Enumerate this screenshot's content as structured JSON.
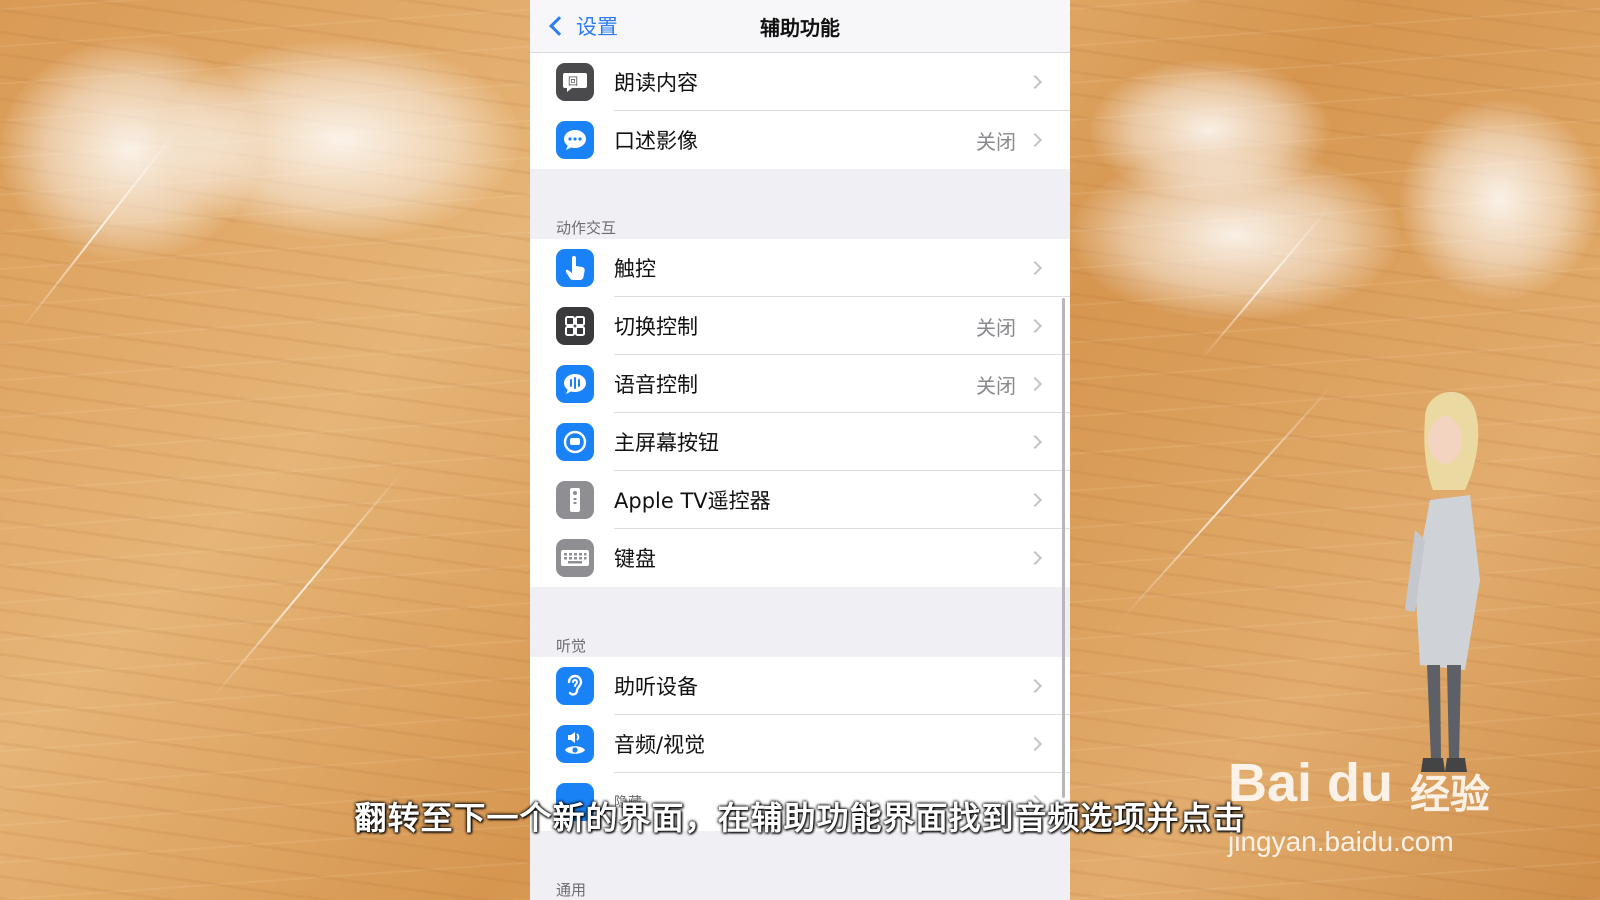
{
  "nav": {
    "back_label": "设置",
    "title": "辅助功能"
  },
  "groups": [
    {
      "header": "",
      "rows": [
        {
          "label": "朗读内容",
          "value": "",
          "icon": "speech-bubble-icon",
          "color": "#4a4a4d"
        },
        {
          "label": "口述影像",
          "value": "关闭",
          "icon": "chat-bubble-icon",
          "color": "#1a82f7"
        }
      ]
    },
    {
      "header": "动作交互",
      "rows": [
        {
          "label": "触控",
          "value": "",
          "icon": "hand-pointer-icon",
          "color": "#1a82f7"
        },
        {
          "label": "切换控制",
          "value": "关闭",
          "icon": "grid-icon",
          "color": "#3a3a3c"
        },
        {
          "label": "语音控制",
          "value": "关闭",
          "icon": "voice-bubble-icon",
          "color": "#1a82f7"
        },
        {
          "label": "主屏幕按钮",
          "value": "",
          "icon": "home-button-icon",
          "color": "#1a82f7"
        },
        {
          "label": "Apple TV遥控器",
          "value": "",
          "icon": "remote-icon",
          "color": "#8e8e93"
        },
        {
          "label": "键盘",
          "value": "",
          "icon": "keyboard-icon",
          "color": "#8e8e93"
        }
      ]
    },
    {
      "header": "听觉",
      "rows": [
        {
          "label": "助听设备",
          "value": "",
          "icon": "ear-icon",
          "color": "#1a82f7"
        },
        {
          "label": "音频/视觉",
          "value": "",
          "icon": "speaker-eye-icon",
          "color": "#1a82f7"
        },
        {
          "label": "隐藏",
          "value": "",
          "icon": "captions-icon",
          "color": "#1a82f7"
        }
      ]
    },
    {
      "header": "通用",
      "rows": []
    }
  ],
  "subtitle": "翻转至下一个新的界面，在辅助功能界面找到音频选项并点击",
  "watermark": {
    "logo": "Bai du",
    "brand_cn": "经验",
    "url": "jingyan.baidu.com"
  }
}
